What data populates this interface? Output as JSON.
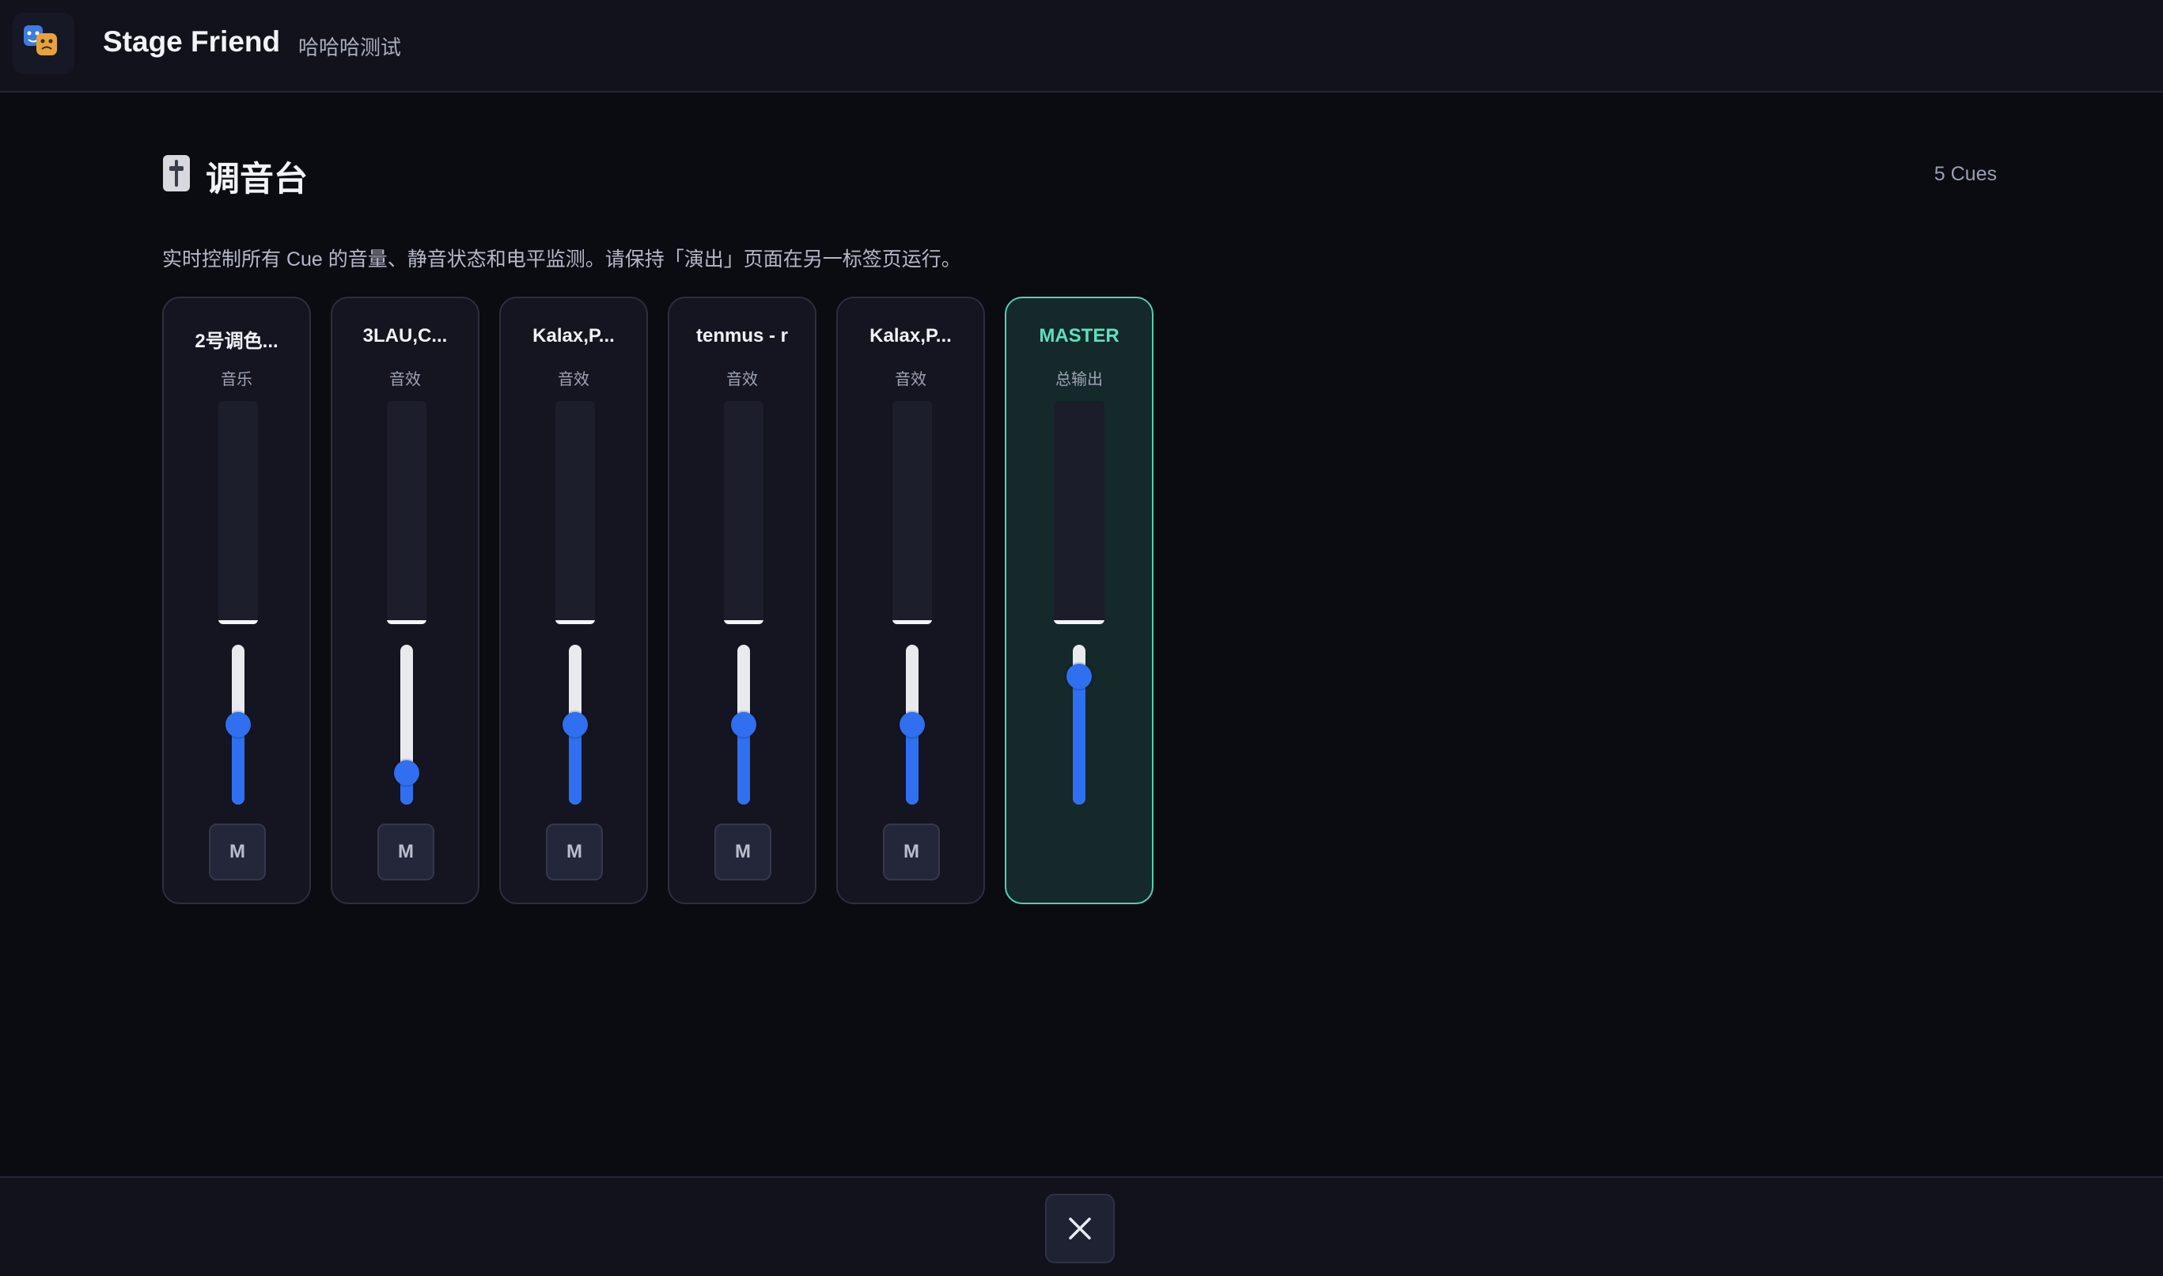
{
  "header": {
    "logo_icon": "theater-masks-icon",
    "app_title": "Stage Friend",
    "project_name": "哈哈哈测试"
  },
  "page": {
    "icon": "mixer-fader-icon",
    "title": "调音台",
    "cue_count": "5 Cues",
    "description": "实时控制所有 Cue 的音量、静音状态和电平监测。请保持「演出」页面在另一标签页运行。"
  },
  "channels": [
    {
      "name": "2号调色...",
      "type": "音乐",
      "volume": 0.5,
      "meter_level": 0.0,
      "mute_label": "M"
    },
    {
      "name": "3LAU,C...",
      "type": "音效",
      "volume": 0.2,
      "meter_level": 0.0,
      "mute_label": "M"
    },
    {
      "name": "Kalax,P...",
      "type": "音效",
      "volume": 0.5,
      "meter_level": 0.0,
      "mute_label": "M"
    },
    {
      "name": "tenmus - r",
      "type": "音效",
      "volume": 0.5,
      "meter_level": 0.0,
      "mute_label": "M"
    },
    {
      "name": "Kalax,P...",
      "type": "音效",
      "volume": 0.5,
      "meter_level": 0.0,
      "mute_label": "M"
    }
  ],
  "master": {
    "name": "MASTER",
    "type": "总输出",
    "volume": 0.8,
    "meter_level": 0.0
  },
  "footer": {
    "close_icon": "close-icon"
  },
  "colors": {
    "accent_blue": "#2f6ff0",
    "master_green": "#5ee0bd",
    "background": "#0b0b12"
  }
}
